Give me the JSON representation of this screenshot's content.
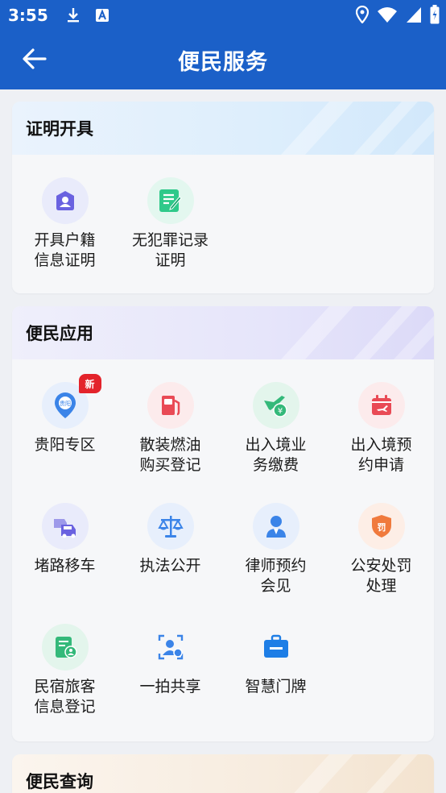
{
  "status_bar": {
    "time": "3:55"
  },
  "header": {
    "title": "便民服务"
  },
  "sections": [
    {
      "title": "证明开具",
      "items": [
        {
          "label": "开具户籍\n信息证明",
          "icon": "user-lock-icon"
        },
        {
          "label": "无犯罪记录\n证明",
          "icon": "document-edit-icon"
        }
      ]
    },
    {
      "title": "便民应用",
      "items": [
        {
          "label": "贵阳专区",
          "icon": "guiyang-pin-icon",
          "badge": "新"
        },
        {
          "label": "散装燃油\n购买登记",
          "icon": "fuel-pump-icon"
        },
        {
          "label": "出入境业\n务缴费",
          "icon": "plane-payment-icon"
        },
        {
          "label": "出入境预\n约申请",
          "icon": "calendar-plane-icon"
        },
        {
          "label": "堵路移车",
          "icon": "cars-icon"
        },
        {
          "label": "执法公开",
          "icon": "scales-icon"
        },
        {
          "label": "律师预约\n会见",
          "icon": "lawyer-icon"
        },
        {
          "label": "公安处罚\n处理",
          "icon": "penalty-shield-icon"
        },
        {
          "label": "民宿旅客\n信息登记",
          "icon": "guest-register-icon"
        },
        {
          "label": "一拍共享",
          "icon": "photo-share-icon"
        },
        {
          "label": "智慧门牌",
          "icon": "door-plate-icon"
        }
      ]
    },
    {
      "title": "便民查询",
      "items": []
    }
  ],
  "colors": {
    "primary": "#1b60c8",
    "badge": "#e3232b"
  }
}
